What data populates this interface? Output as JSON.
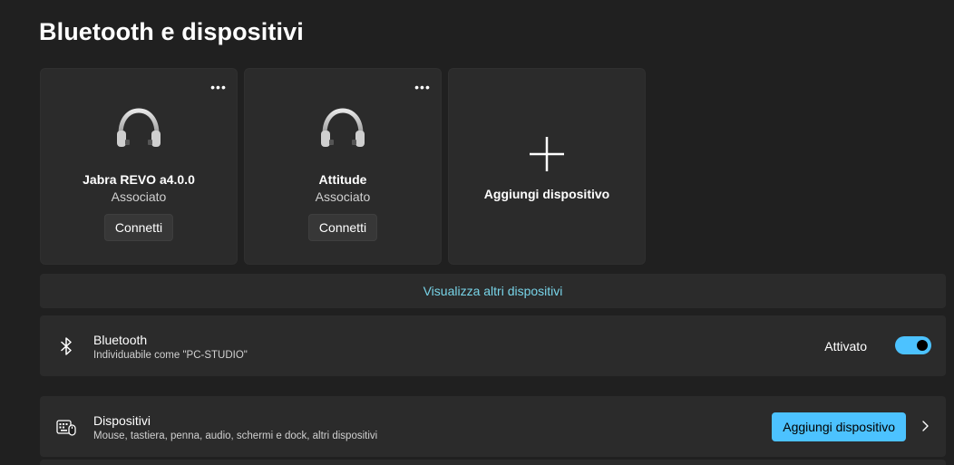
{
  "page": {
    "title": "Bluetooth e dispositivi"
  },
  "devices": [
    {
      "name": "Jabra REVO a4.0.0",
      "status": "Associato",
      "connect_label": "Connetti",
      "more_label": "•••",
      "icon": "headphones-icon"
    },
    {
      "name": "Attitude",
      "status": "Associato",
      "connect_label": "Connetti",
      "more_label": "•••",
      "icon": "headphones-icon"
    }
  ],
  "add_card": {
    "label": "Aggiungi dispositivo",
    "icon": "plus-icon"
  },
  "view_more": {
    "label": "Visualizza altri dispositivi"
  },
  "bluetooth": {
    "title": "Bluetooth",
    "subtitle": "Individuabile come \"PC-STUDIO\"",
    "state_label": "Attivato",
    "enabled": true,
    "icon": "bluetooth-icon"
  },
  "devices_row": {
    "title": "Dispositivi",
    "subtitle": "Mouse, tastiera, penna, audio, schermi e dock, altri dispositivi",
    "button_label": "Aggiungi dispositivo",
    "icon": "keyboard-mouse-icon"
  },
  "colors": {
    "background": "#202020",
    "card": "#2b2b2b",
    "accent": "#4cc2ff",
    "link": "#78d4e8"
  }
}
